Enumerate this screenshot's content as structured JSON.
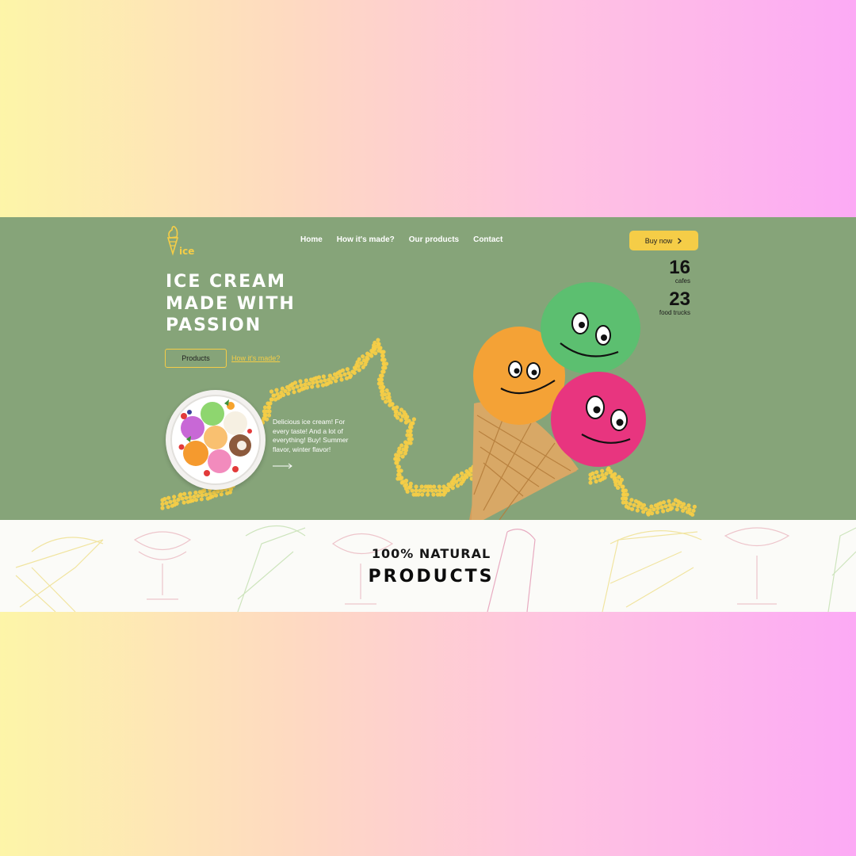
{
  "brand": {
    "logo_text": "ice",
    "logo_icon": "ice-cream-cone-icon"
  },
  "nav": {
    "items": [
      {
        "label": "Home"
      },
      {
        "label": "How it's made?"
      },
      {
        "label": "Our products"
      },
      {
        "label": "Contact"
      }
    ]
  },
  "buy_button": {
    "label": "Buy now",
    "icon": "chevron-right-icon"
  },
  "hero": {
    "headline_lines": [
      "ICE CREAM",
      "MADE WITH",
      "PASSION"
    ],
    "primary_button": "Products",
    "secondary_link": "How it's made?",
    "description": "Delicious ice cream! For every taste! And a lot of everything! Buy! Summer flavor, winter flavor!",
    "arrow_icon": "arrow-right-icon"
  },
  "stats": [
    {
      "value": "16",
      "label": "cafes"
    },
    {
      "value": "23",
      "label": "food trucks"
    }
  ],
  "section": {
    "title": "100% NATURAL",
    "subtitle": "PRODUCTS"
  },
  "colors": {
    "hero_bg": "#86a479",
    "accent": "#f5cd47",
    "text_dark": "#121212",
    "scoop_green": "#5cbf70",
    "scoop_orange": "#f4a236",
    "scoop_pink": "#e8357f"
  }
}
